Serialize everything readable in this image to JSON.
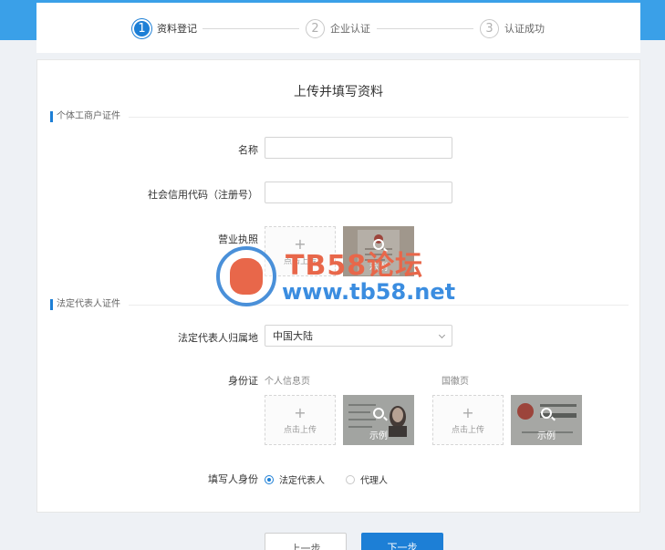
{
  "steps": [
    {
      "num": "1",
      "label": "资料登记"
    },
    {
      "num": "2",
      "label": "企业认证"
    },
    {
      "num": "3",
      "label": "认证成功"
    }
  ],
  "form": {
    "title": "上传并填写资料",
    "section_business": "个体工商户证件",
    "name_label": "名称",
    "name_value": "",
    "credit_code_label": "社会信用代码（注册号）",
    "credit_code_value": "",
    "license_label": "营业执照",
    "upload_text": "点击上传",
    "upload_plus": "+",
    "sample_text": "示例",
    "section_legal": "法定代表人证件",
    "region_label": "法定代表人归属地",
    "region_value": "中国大陆",
    "id_label": "身份证",
    "id_front_label": "个人信息页",
    "id_back_label": "国徽页",
    "filler_label": "填写人身份",
    "filler_options": [
      "法定代表人",
      "代理人"
    ],
    "filler_selected": "法定代表人"
  },
  "buttons": {
    "prev": "上一步",
    "next": "下一步"
  },
  "watermark": {
    "title": "TB58论坛",
    "url": "www.tb58.net"
  },
  "colors": {
    "accent": "#1d7fd6",
    "top_band": "#3aa0e8",
    "watermark_red": "#e8674a",
    "watermark_blue": "#3b8de0"
  }
}
